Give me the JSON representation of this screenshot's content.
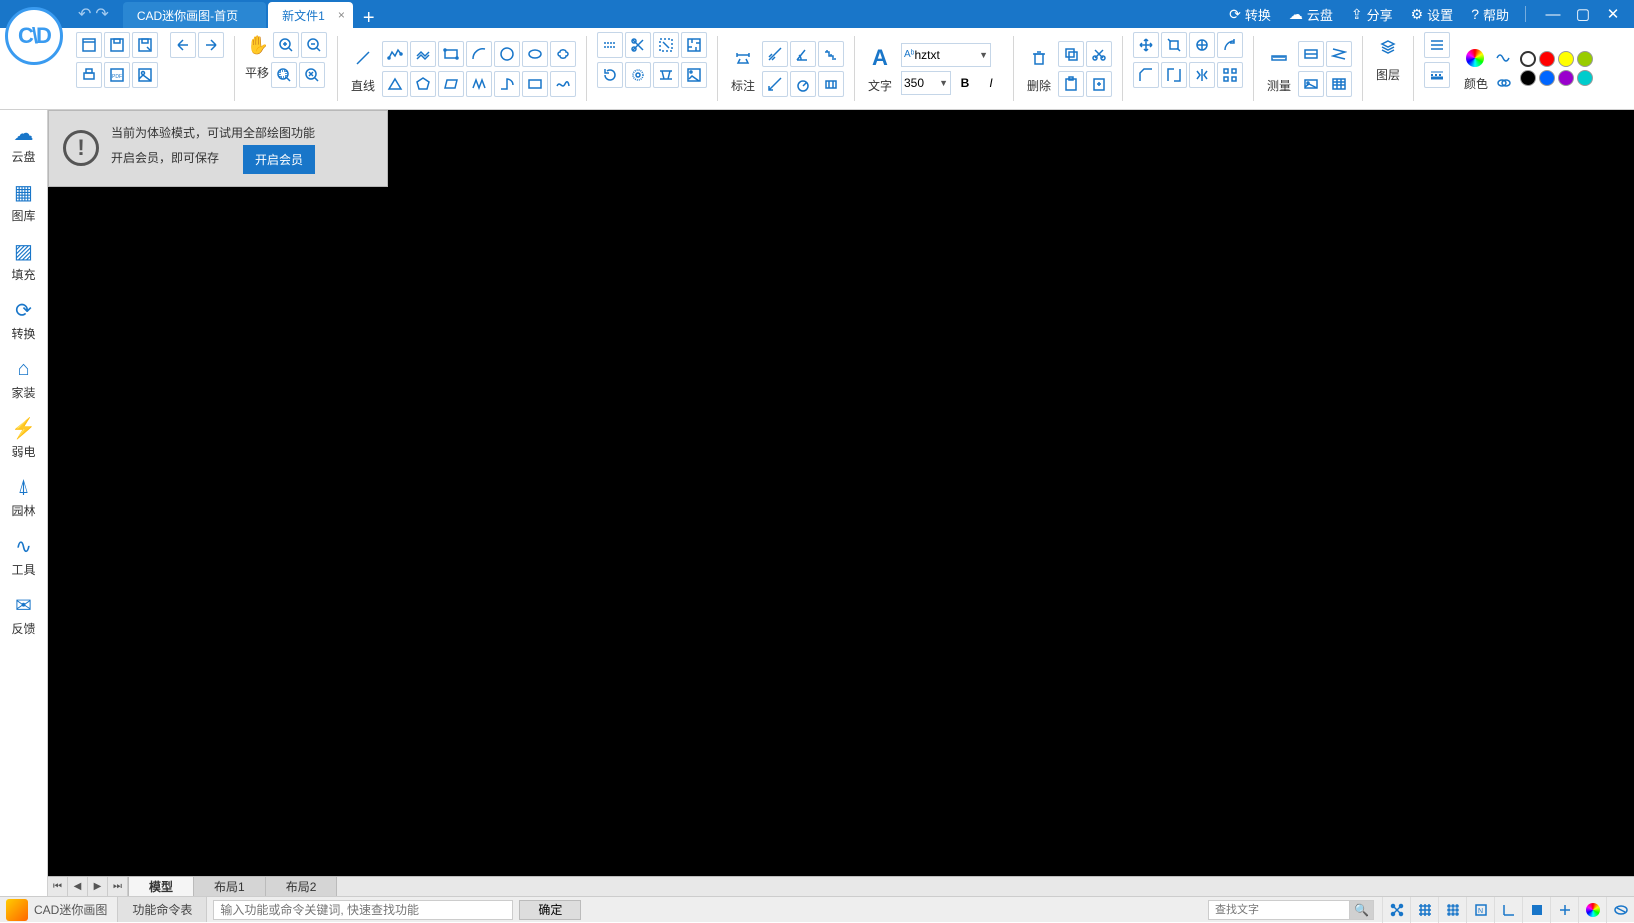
{
  "titlebar": {
    "tabs": [
      {
        "label": "CAD迷你画图-首页",
        "active": false
      },
      {
        "label": "新文件1",
        "active": true
      }
    ],
    "links": {
      "convert": "转换",
      "cloud": "云盘",
      "share": "分享",
      "settings": "设置",
      "help": "帮助"
    }
  },
  "ribbon": {
    "pan": "平移",
    "line": "直线",
    "annotate": "标注",
    "text": "文字",
    "font": "hztxt",
    "size": "350",
    "bold": "B",
    "italic": "I",
    "delete": "删除",
    "measure": "测量",
    "layer": "图层",
    "color": "颜色"
  },
  "sidebar": [
    {
      "icon": "cloud",
      "label": "云盘"
    },
    {
      "icon": "gallery",
      "label": "图库"
    },
    {
      "icon": "hatch",
      "label": "填充"
    },
    {
      "icon": "convert",
      "label": "转换"
    },
    {
      "icon": "home",
      "label": "家装"
    },
    {
      "icon": "electric",
      "label": "弱电"
    },
    {
      "icon": "garden",
      "label": "园林"
    },
    {
      "icon": "tools",
      "label": "工具"
    },
    {
      "icon": "feedback",
      "label": "反馈"
    }
  ],
  "banner": {
    "line1": "当前为体验模式，可试用全部绘图功能",
    "line2": "开启会员，即可保存",
    "button": "开启会员"
  },
  "layoutTabs": {
    "tabs": [
      "模型",
      "布局1",
      "布局2"
    ],
    "active": 0
  },
  "cmdbar": {
    "title": "CAD迷你画图",
    "fnlist": "功能命令表",
    "placeholder": "输入功能或命令关键词, 快速查找功能",
    "ok": "确定",
    "searchPlaceholder": "查找文字"
  },
  "colors": {
    "row1": [
      "#ffffff",
      "#ff0000",
      "#ffff00",
      "#99cc00"
    ],
    "row2": [
      "#000000",
      "#0066ff",
      "#9900cc",
      "#00cccc"
    ]
  }
}
